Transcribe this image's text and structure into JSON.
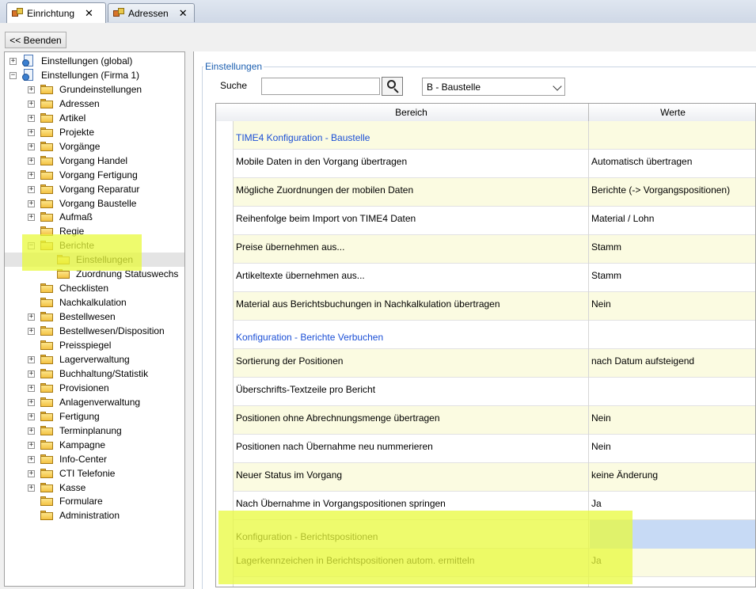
{
  "tabs": [
    {
      "label": "Einrichtung",
      "active": true,
      "icon": "module-icon"
    },
    {
      "label": "Adressen",
      "active": false,
      "icon": "module-icon"
    }
  ],
  "toolbar": {
    "back_label": "<< Beenden"
  },
  "tree": {
    "roots": [
      {
        "label": "Einstellungen (global)",
        "expander": "+"
      },
      {
        "label": "Einstellungen (Firma 1)",
        "expander": "−"
      }
    ],
    "items": [
      {
        "label": "Grundeinstellungen",
        "expander": "+"
      },
      {
        "label": "Adressen",
        "expander": "+"
      },
      {
        "label": "Artikel",
        "expander": "+"
      },
      {
        "label": "Projekte",
        "expander": "+"
      },
      {
        "label": "Vorgänge",
        "expander": "+"
      },
      {
        "label": "Vorgang Handel",
        "expander": "+"
      },
      {
        "label": "Vorgang Fertigung",
        "expander": "+"
      },
      {
        "label": "Vorgang Reparatur",
        "expander": "+"
      },
      {
        "label": "Vorgang Baustelle",
        "expander": "+"
      },
      {
        "label": "Aufmaß",
        "expander": "+"
      },
      {
        "label": "Regie",
        "expander": ""
      },
      {
        "label": "Berichte",
        "expander": "−"
      },
      {
        "label": "Einstellungen",
        "expander": "",
        "child": true,
        "selected": true
      },
      {
        "label": "Zuordnung Statuswechs",
        "expander": "",
        "child": true
      },
      {
        "label": "Checklisten",
        "expander": ""
      },
      {
        "label": "Nachkalkulation",
        "expander": ""
      },
      {
        "label": "Bestellwesen",
        "expander": "+"
      },
      {
        "label": "Bestellwesen/Disposition",
        "expander": "+"
      },
      {
        "label": "Preisspiegel",
        "expander": ""
      },
      {
        "label": "Lagerverwaltung",
        "expander": "+"
      },
      {
        "label": "Buchhaltung/Statistik",
        "expander": "+"
      },
      {
        "label": "Provisionen",
        "expander": "+"
      },
      {
        "label": "Anlagenverwaltung",
        "expander": "+"
      },
      {
        "label": "Fertigung",
        "expander": "+"
      },
      {
        "label": "Terminplanung",
        "expander": "+"
      },
      {
        "label": "Kampagne",
        "expander": "+"
      },
      {
        "label": "Info-Center",
        "expander": "+"
      },
      {
        "label": "CTI Telefonie",
        "expander": "+"
      },
      {
        "label": "Kasse",
        "expander": "+"
      },
      {
        "label": "Formulare",
        "expander": ""
      },
      {
        "label": "Administration",
        "expander": ""
      }
    ]
  },
  "settings": {
    "group_title": "Einstellungen",
    "search_label": "Suche",
    "search_value": "",
    "combo_value": "B - Baustelle",
    "columns": {
      "bereich": "Bereich",
      "werte": "Werte"
    },
    "rows": [
      {
        "bereich": "TIME4 Konfiguration - Baustelle",
        "werte": "",
        "header": true,
        "style": "yellow"
      },
      {
        "bereich": "Mobile Daten in den Vorgang übertragen",
        "werte": "Automatisch übertragen",
        "style": "white"
      },
      {
        "bereich": "Mögliche Zuordnungen der mobilen Daten",
        "werte": "Berichte (-> Vorgangspositionen)",
        "style": "yellow"
      },
      {
        "bereich": "Reihenfolge beim Import von TIME4 Daten",
        "werte": "Material / Lohn",
        "style": "white"
      },
      {
        "bereich": "Preise übernehmen aus...",
        "werte": "Stamm",
        "style": "yellow"
      },
      {
        "bereich": "Artikeltexte übernehmen aus...",
        "werte": "Stamm",
        "style": "white"
      },
      {
        "bereich": "Material aus Berichtsbuchungen in Nachkalkulation übertragen",
        "werte": "Nein",
        "style": "yellow"
      },
      {
        "bereich": "Konfiguration - Berichte Verbuchen",
        "werte": "",
        "header": true,
        "style": "white"
      },
      {
        "bereich": "Sortierung der Positionen",
        "werte": "nach Datum aufsteigend",
        "style": "yellow"
      },
      {
        "bereich": "Überschrifts-Textzeile pro Bericht",
        "werte": "",
        "style": "white"
      },
      {
        "bereich": "Positionen ohne Abrechnungsmenge übertragen",
        "werte": "Nein",
        "style": "yellow"
      },
      {
        "bereich": "Positionen nach Übernahme neu nummerieren",
        "werte": "Nein",
        "style": "white"
      },
      {
        "bereich": "Neuer Status im Vorgang",
        "werte": "keine Änderung",
        "style": "yellow"
      },
      {
        "bereich": "Nach Übernahme in Vorgangspositionen springen",
        "werte": "Ja",
        "style": "white"
      },
      {
        "bereich": "Konfiguration - Berichtspositionen",
        "werte": "",
        "header": true,
        "style": "selected",
        "focused": true
      },
      {
        "bereich": "Lagerkennzeichen in Berichtspositionen autom. ermitteln",
        "werte": "Ja",
        "style": "yellow"
      }
    ]
  },
  "colors": {
    "highlight_marker": "#e8fa3c",
    "section_header_text": "#1b4fd6",
    "group_title": "#1c5fb0",
    "row_alt": "#fbfbe1",
    "focused_cell": "#c7daf5"
  }
}
